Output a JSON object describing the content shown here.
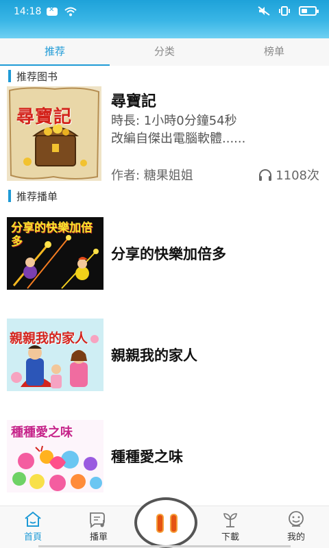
{
  "status_bar": {
    "time": "14:18"
  },
  "tabs": [
    {
      "label": "推荐",
      "active": true
    },
    {
      "label": "分类",
      "active": false
    },
    {
      "label": "榜单",
      "active": false
    }
  ],
  "sections": {
    "recommended_books": "推荐图书",
    "recommended_playlists": "推荐播单"
  },
  "book": {
    "cover_text": "尋寶記",
    "title": "尋寶記",
    "duration": "時長: 1小時0分鐘54秒",
    "description": "改編自傑出電腦軟體......",
    "author": "作者:  糖果姐姐",
    "plays": "1108次",
    "icon": "headphones-icon"
  },
  "playlists": [
    {
      "cover_text": "分享的快樂加倍多",
      "title": "分享的快樂加倍多"
    },
    {
      "cover_text": "親親我的家人",
      "title": "親親我的家人"
    },
    {
      "cover_text": "種種愛之味",
      "title": "種種愛之味"
    }
  ],
  "bottom_nav": {
    "home": "首頁",
    "playlist": "播單",
    "download": "下載",
    "mine": "我的"
  },
  "colors": {
    "accent": "#1e9ad6",
    "status_bar": "#2aa9df",
    "play_button": "#e55312"
  }
}
